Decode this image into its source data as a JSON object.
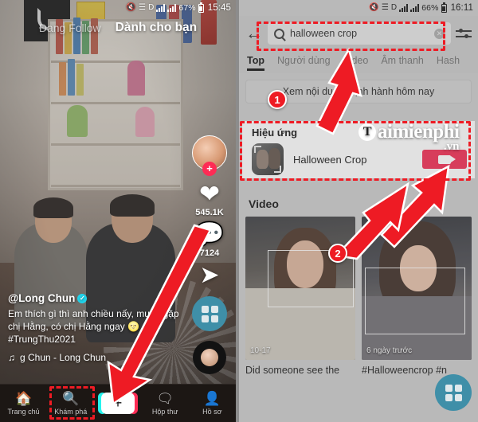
{
  "left_phone": {
    "status_bar": {
      "mute_icon": "mute-icon",
      "wifi_icon": "wifi-icon",
      "data_icon": "D",
      "signal_icon": "signal-bars",
      "battery": "67%",
      "time": "15:45"
    },
    "top_tabs": [
      {
        "label": "Đang Follow",
        "active": false
      },
      {
        "label": "Dành cho bạn",
        "active": true
      }
    ],
    "action_rail": {
      "avatar_plus": "+",
      "like_icon": "heart-icon",
      "like_count": "545.1K",
      "comment_icon": "comment-icon",
      "comment_count": "7124",
      "share_icon": "share-arrow-icon",
      "grid_icon": "grid-icon",
      "disc_icon": "music-disc-icon"
    },
    "caption": {
      "username": "@Long Chun",
      "verified_icon": "verified-badge-icon",
      "text": "Em thích gì thì anh chiều nấy, muốn gặp chị Hằng, có chị Hằng ngay 🌝 #TrungThu2021",
      "music_icon": "music-note-icon",
      "music": "g Chun - Long Chun"
    },
    "bottom_nav": [
      {
        "label": "Trang chủ",
        "icon": "home-icon"
      },
      {
        "label": "Khám phá",
        "icon": "search-icon"
      },
      {
        "label": "",
        "icon": "create-plus-icon"
      },
      {
        "label": "Hộp thư",
        "icon": "inbox-icon"
      },
      {
        "label": "Hồ sơ",
        "icon": "profile-icon"
      }
    ]
  },
  "right_phone": {
    "status_bar": {
      "mute_icon": "mute-icon",
      "wifi_icon": "wifi-icon",
      "data_icon": "D",
      "signal_icon": "signal-bars",
      "battery": "66%",
      "time": "16:11"
    },
    "header": {
      "back_icon": "back-arrow-icon",
      "search_icon": "search-icon",
      "search_value": "halloween crop",
      "clear_icon": "clear-x-icon",
      "filter_icon": "filter-sliders-icon"
    },
    "tabs": [
      {
        "label": "Top",
        "active": true
      },
      {
        "label": "Người dùng",
        "active": false
      },
      {
        "label": "Video",
        "active": false
      },
      {
        "label": "Âm thanh",
        "active": false
      },
      {
        "label": "Hash",
        "active": false
      }
    ],
    "banner": "Xem nội dung thịnh hành hôm nay",
    "effects": {
      "title": "Hiệu ứng",
      "item_name": "Halloween Crop",
      "thumb_icon": "effect-thumbnail",
      "use_button_icon": "video-camera-icon"
    },
    "video_section": {
      "title": "Video",
      "items": [
        {
          "date": "10-17",
          "caption": "Did someone see the"
        },
        {
          "date": "6 ngày trước",
          "caption": "#Halloweencrop #n"
        }
      ]
    },
    "fab_icon": "grid-icon",
    "watermark": {
      "mark": "T",
      "main": "aimienphi",
      "sub": ".vn"
    }
  },
  "annotations": {
    "badge_1": "1",
    "badge_2": "2",
    "highlight_color": "#ee1b24",
    "accent_pink": "#ef2950",
    "accent_teal": "#3f8fa8"
  }
}
